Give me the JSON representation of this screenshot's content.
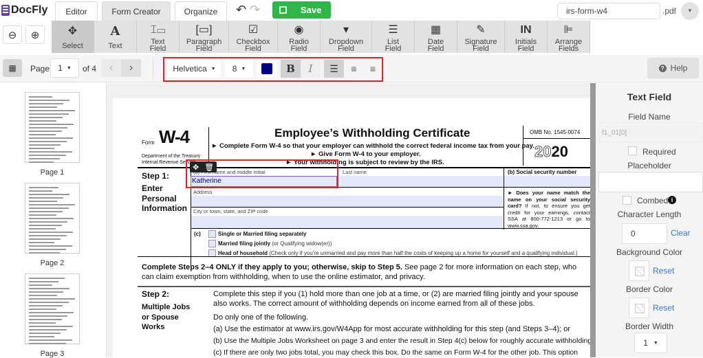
{
  "app": {
    "logo": "DocFly"
  },
  "tabs": [
    {
      "label": "Editor"
    },
    {
      "label": "Form Creator"
    },
    {
      "label": "Organize"
    }
  ],
  "save_label": "Save",
  "filename": {
    "value": "irs-form-w4",
    "ext": ".pdf"
  },
  "tools": [
    {
      "l1": "Select",
      "l2": "",
      "icon": "move-icon"
    },
    {
      "l1": "Text",
      "l2": "",
      "icon": "text-icon"
    },
    {
      "l1": "Text",
      "l2": "Field",
      "icon": "text-field-icon"
    },
    {
      "l1": "Paragraph",
      "l2": "Field",
      "icon": "paragraph-field-icon"
    },
    {
      "l1": "Checkbox",
      "l2": "Field",
      "icon": "checkbox-icon"
    },
    {
      "l1": "Radio",
      "l2": "Field",
      "icon": "radio-icon"
    },
    {
      "l1": "Dropdown",
      "l2": "Field",
      "icon": "dropdown-icon"
    },
    {
      "l1": "List",
      "l2": "Field",
      "icon": "list-icon"
    },
    {
      "l1": "Date",
      "l2": "Field",
      "icon": "calendar-icon"
    },
    {
      "l1": "Signature",
      "l2": "Field",
      "icon": "signature-icon"
    },
    {
      "l1": "Initials",
      "l2": "Field",
      "icon": "initials-icon"
    },
    {
      "l1": "Arrange",
      "l2": "Fields",
      "icon": "arrange-icon"
    }
  ],
  "initials_glyph": "IN",
  "pager": {
    "label": "Page",
    "current": "1",
    "of": "of 4"
  },
  "format": {
    "font": "Helvetica",
    "size": "8",
    "color": "#000080",
    "bold": "B",
    "italic": "I"
  },
  "help_label": "Help",
  "thumbnails": [
    {
      "label": "Page 1"
    },
    {
      "label": "Page 2"
    },
    {
      "label": "Page 3"
    }
  ],
  "form": {
    "form_word": "Form",
    "form_id": "W-4",
    "dept1": "Department of the Treasury",
    "dept2": "Internal Revenue Service",
    "title": "Employee’s Withholding Certificate",
    "line1": "► Complete Form W-4 so that your employer can withhold the correct federal income tax from your pay.",
    "line2": "► Give Form W-4 to your employer.",
    "line3": "► Your withholding is subject to review by the IRS.",
    "omb": "OMB No. 1545-0074",
    "year_light": "20",
    "year_bold": "20",
    "step1": "Step 1:",
    "step1_sub": "Enter Personal Information",
    "first_name_label": "(a) First name and middle initial",
    "first_name_value": "Katherine",
    "last_name_label": "Last name",
    "ssn_label": "(b)  Social security number",
    "address_label": "Address",
    "city_label": "City or town, state, and ZIP code",
    "ssn_note_bold": "► Does your name match the name on your social security card?",
    "ssn_note": " If not, to ensure you get credit for your earnings, contact SSA at 800-772-1213 or go to www.ssa.gov.",
    "c_label": "(c)",
    "filing": [
      {
        "bold": "Single or Married filing separately",
        "rest": ""
      },
      {
        "bold": "Married filing jointly",
        "rest": " (or Qualifying widow(er))"
      },
      {
        "bold": "Head of household",
        "rest": " (Check only if you're unmarried and pay more than half the costs of keeping up a home for yourself and a qualifying individual.)"
      }
    ],
    "steps_note_bold": "Complete Steps 2–4 ONLY if they apply to you; otherwise, skip to Step 5.",
    "steps_note": " See page 2 for more information on each step, who can claim exemption from withholding, when to use the online estimator, and privacy.",
    "step2": "Step 2:",
    "step2_sub": "Multiple Jobs or Spouse Works",
    "step2_p1": "Complete this step if you (1) hold more than one job at a time, or (2) are married filing jointly and your spouse also works. The correct amount of withholding depends on income earned from all of these jobs.",
    "step2_p2": "Do only one of the following.",
    "step2_a": "(a)  Use the estimator at www.irs.gov/W4App for most accurate withholding for this step (and Steps 3–4); or",
    "step2_b": "(b)  Use the Multiple Jobs Worksheet on page 3 and enter the result in Step 4(c) below for roughly accurate withholding; or",
    "step2_c": "(c)  If there are only two jobs total, you may check this box. Do the same on Form W-4 for the other job. This option"
  },
  "panel": {
    "title": "Text Field",
    "field_name_label": "Field Name",
    "field_name_value": "f1_01[0]",
    "required_label": "Required",
    "placeholder_label": "Placeholder",
    "placeholder_value": "",
    "combed_label": "Combed",
    "char_length_label": "Character Length",
    "char_length_value": "0",
    "clear_label": "Clear",
    "bg_color_label": "Background Color",
    "reset_label": "Reset",
    "border_color_label": "Border Color",
    "border_width_label": "Border Width",
    "border_width_value": "1"
  },
  "colors": {
    "save": "#2fb54a",
    "highlight": "#d9262e",
    "accent": "#6b3fa0"
  }
}
